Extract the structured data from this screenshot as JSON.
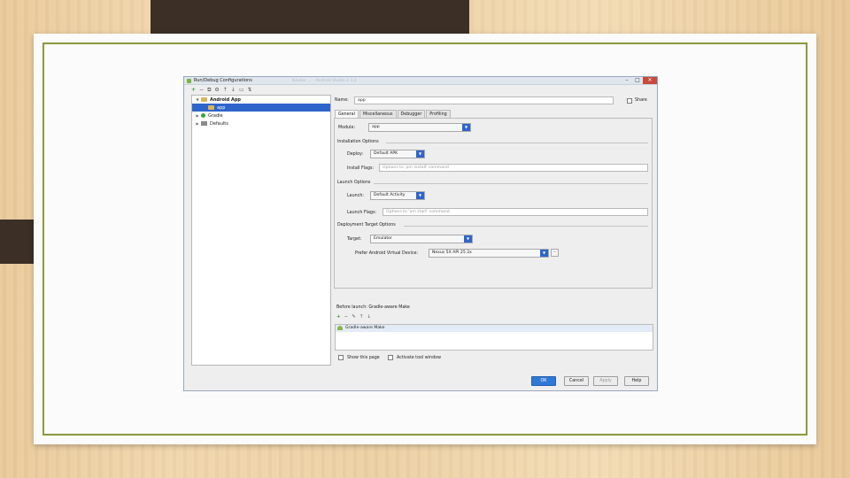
{
  "dialog": {
    "title": "Run/Debug Configurations",
    "ghost_title": "Navbar ... - Android Studio 2.3.3",
    "window_buttons": [
      "–",
      "□",
      "✕"
    ]
  },
  "left_toolbar": [
    "+",
    "−",
    "⧉",
    "⚙",
    "↑",
    "↓",
    "▭",
    "⇅"
  ],
  "tree": [
    {
      "label": "Android App",
      "expanded": true,
      "icon": "android-app-icon"
    },
    {
      "label": "app",
      "selected": true,
      "icon": "app-module-icon"
    },
    {
      "label": "Gradle",
      "icon": "gradle-icon"
    },
    {
      "label": "Defaults",
      "icon": "defaults-icon"
    }
  ],
  "name_label": "Name:",
  "name_value": "app",
  "share_label": "Share",
  "tabs": [
    "General",
    "Miscellaneous",
    "Debugger",
    "Profiling"
  ],
  "general": {
    "module_label": "Module:",
    "module_value": "app",
    "installation_section": "Installation Options",
    "deploy_label": "Deploy:",
    "deploy_value": "Default APK",
    "install_flags_label": "Install Flags:",
    "install_flags_placeholder": "Options to 'pm install' command",
    "launch_section": "Launch Options",
    "launch_label": "Launch:",
    "launch_value": "Default Activity",
    "launch_flags_label": "Launch Flags:",
    "launch_flags_placeholder": "Options to 'am start' command",
    "deploy_target_section": "Deployment Target Options",
    "target_label": "Target:",
    "target_value": "Emulator",
    "prefer_avd_label": "Prefer Android Virtual Device:",
    "prefer_avd_value": "Nexus 5X API 25 2x",
    "browse_label": "..."
  },
  "before_launch": {
    "header": "Before launch: Gradle-aware Make",
    "toolbar": [
      "+",
      "−",
      "✎",
      "↑",
      "↓"
    ],
    "items": [
      "Gradle-aware Make"
    ]
  },
  "show_page_label": "Show this page",
  "activate_tool_window_label": "Activate tool window",
  "buttons": {
    "ok": "OK",
    "cancel": "Cancel",
    "apply": "Apply",
    "help": "Help"
  }
}
